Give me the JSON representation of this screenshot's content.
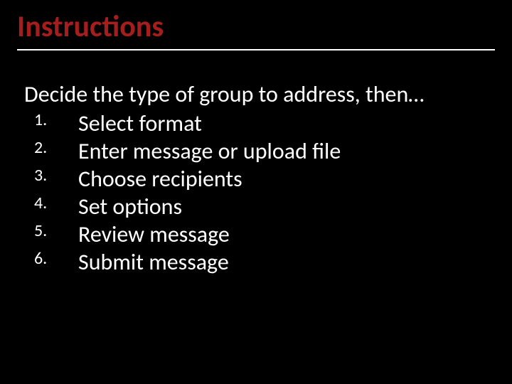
{
  "title": "Instructions",
  "intro": "Decide the type of group to address, then…",
  "steps": [
    "Select format",
    "Enter message or upload file",
    "Choose recipients",
    "Set options",
    "Review message",
    "Submit message"
  ]
}
